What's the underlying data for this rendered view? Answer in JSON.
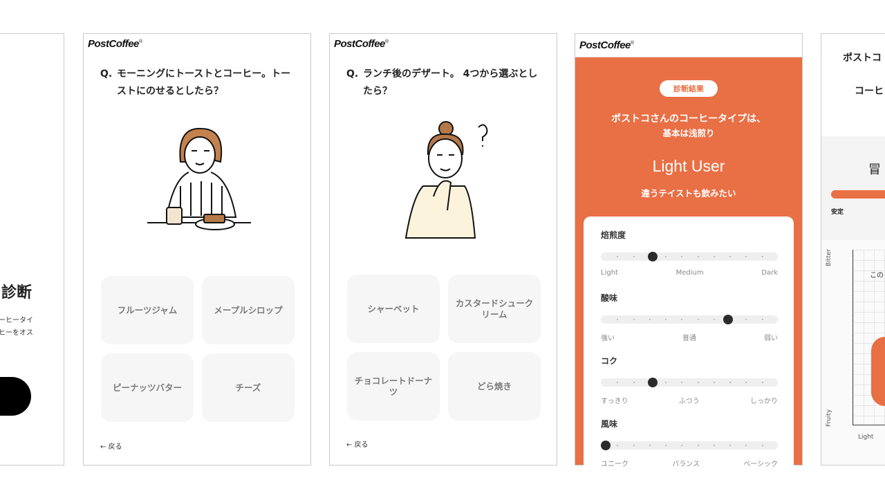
{
  "screen_intro": {
    "title_fragment": "診断",
    "desc_lines": [
      "ーヒータイ",
      "ヒーをオス"
    ]
  },
  "brand": {
    "logo": "PostCoffee",
    "reg": "®",
    "accent": "#e96f45"
  },
  "screen_q1": {
    "q_mark": "Q.",
    "question": "モーニングにトーストとコーヒー。トーストにのせるとしたら？",
    "options": [
      "フルーツジャム",
      "メープルシロップ",
      "ピーナッツバター",
      "チーズ"
    ],
    "back": "← 戻る"
  },
  "screen_q2": {
    "q_mark": "Q.",
    "question": "ランチ後のデザート。 4つから選ぶとしたら？",
    "options": [
      "シャーベット",
      "カスタードシュークリーム",
      "チョコレートドーナツ",
      "どら焼き"
    ],
    "back": "← 戻る"
  },
  "screen_result": {
    "badge": "診断結果",
    "line1": "ポストコさんのコーヒータイプは、",
    "line2": "基本は浅煎り",
    "type": "Light User",
    "tagline": "違うテイストも飲みたい",
    "sliders": [
      {
        "label": "焙煎度",
        "ends": [
          "Light",
          "Medium",
          "Dark"
        ],
        "value": 0.28
      },
      {
        "label": "酸味",
        "ends": [
          "強い",
          "普通",
          "弱い"
        ],
        "value": 0.73
      },
      {
        "label": "コク",
        "ends": [
          "すっきり",
          "ふつう",
          "しっかり"
        ],
        "value": 0.28
      },
      {
        "label": "風味",
        "ends": [
          "ユニーク",
          "バランス",
          "ベーシック"
        ],
        "value": 0.0
      }
    ]
  },
  "screen_detail": {
    "title_line1": "ポストコ",
    "title_line2": "コーヒ",
    "section_title": "冒",
    "bar_left": "安定",
    "axis_top": "Bitter",
    "axis_bottom": "Fruity",
    "axis_left": "Light",
    "chart_note": "この"
  }
}
